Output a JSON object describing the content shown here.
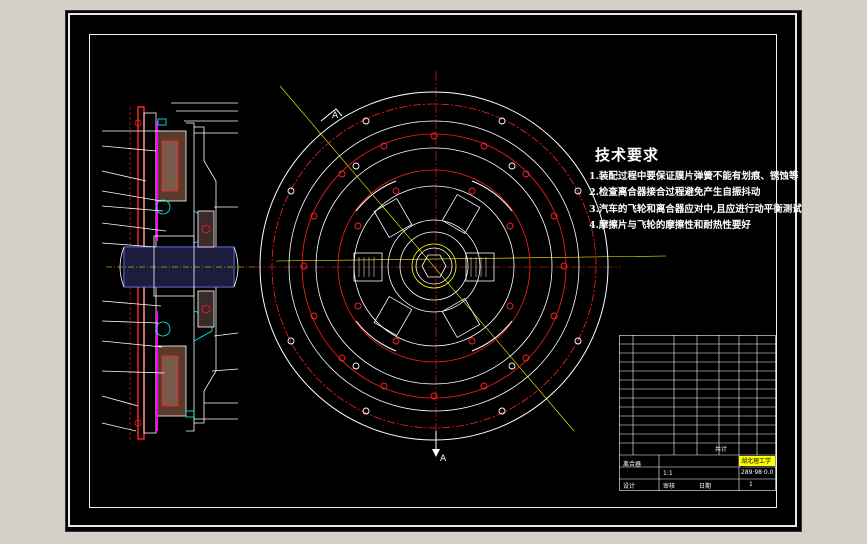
{
  "drawing": {
    "section_mark_top": "A",
    "section_mark_bottom": "A",
    "tech_requirements": {
      "title": "技术要求",
      "items": [
        "1.装配过程中要保证膜片弹簧不能有划痕、锈蚀等",
        "2.检查离合器接合过程避免产生自振抖动",
        "3.汽车的飞轮和离合器应对中,且应进行动平衡测试",
        "4.摩擦片与飞轮的摩擦性和耐热性要好"
      ]
    },
    "title_block": {
      "total_label": "共计",
      "school_name": "湖北理工学院",
      "drawing_name": "离合器",
      "drawing_number": "289·98·0.0",
      "scale": "1:1",
      "sheet": "1",
      "designer_label": "设计",
      "checker_label": "审核",
      "date_label": "日期"
    },
    "colors": {
      "background": "#000000",
      "red": "#ff2020",
      "white": "#ffffff",
      "yellow": "#ffff00",
      "cyan": "#00ffff",
      "magenta": "#ff00ff",
      "green": "#00ff00"
    }
  }
}
